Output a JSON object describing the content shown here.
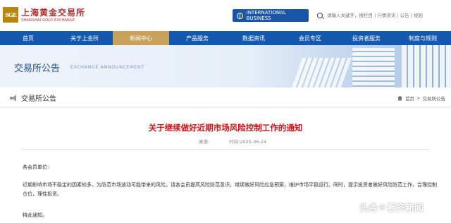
{
  "header": {
    "logo_cn": "上海黄金交易所",
    "logo_en": "SHANGHAI GOLD EXCHANGE",
    "logo_seal": "SGE",
    "intl_label": "INTERNATIONAL BUSINESS",
    "search_placeholder": "请输入关键字，搜栏目 | 行情资讯 | 公告 | 规则"
  },
  "nav": {
    "items": [
      "首页",
      "关于上金所",
      "新闻中心",
      "产品服务",
      "数据资讯",
      "会员专区",
      "投资者服务",
      "制度与规则"
    ],
    "active_index": 2,
    "active_color": "#c8a15a",
    "bar_color": "#1558b0"
  },
  "banner": {
    "title": "交易所公告",
    "subtitle": "EXCHANGE ANNOUNCEMENT"
  },
  "crumbbar": {
    "title": "交易所公告",
    "home": "首页",
    "sep": ">",
    "current": "交易所公告"
  },
  "article": {
    "title": "关于继续做好近期市场风险控制工作的通知",
    "source_label": "来源:",
    "time_label": "时间:2025-06-24",
    "salutation": "各会员单位:",
    "body": "近期影响市场不稳定的因素较多，为防范市场波动可能带来的风险，请各会员提高风险防范意识，继续做好风险应急预案，维护市场平稳运行。同时，提示投资者做好风险防范工作，合理控制仓位，理性投资。",
    "closing": "特此通知。",
    "title_color": "#d0131b"
  },
  "watermark": {
    "prefix": "头条",
    "at": "@",
    "name": "看齐新闻"
  }
}
